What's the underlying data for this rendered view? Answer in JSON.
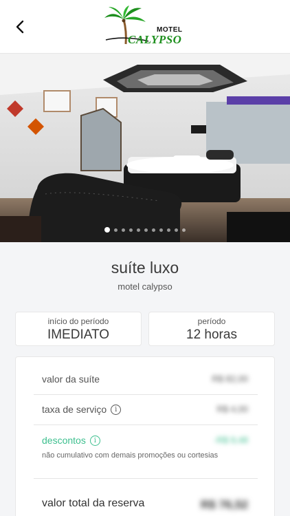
{
  "header": {
    "back_icon": "chevron-left-icon",
    "logo_top_text": "MOTEL",
    "logo_main_text": "CALYPSO"
  },
  "gallery": {
    "total_images": 11,
    "active_index": 0
  },
  "suite": {
    "name": "suíte luxo",
    "motel": "motel calypso"
  },
  "period": {
    "start_label": "início do período",
    "start_value": "IMEDIATO",
    "length_label": "período",
    "length_value": "12 horas"
  },
  "pricing": {
    "suite_label": "valor da suíte",
    "suite_value": "R$ 82,00",
    "service_label": "taxa de serviço",
    "service_value": "R$ 4,00",
    "discount_label": "descontos",
    "discount_value": "-R$ 9,48",
    "discount_note": "não cumulativo com demais promoções ou cortesias",
    "total_label": "valor total da reserva",
    "total_value": "R$ 76,52"
  },
  "colors": {
    "accent_green": "#3cbf8e",
    "logo_green": "#1d8f1d"
  }
}
